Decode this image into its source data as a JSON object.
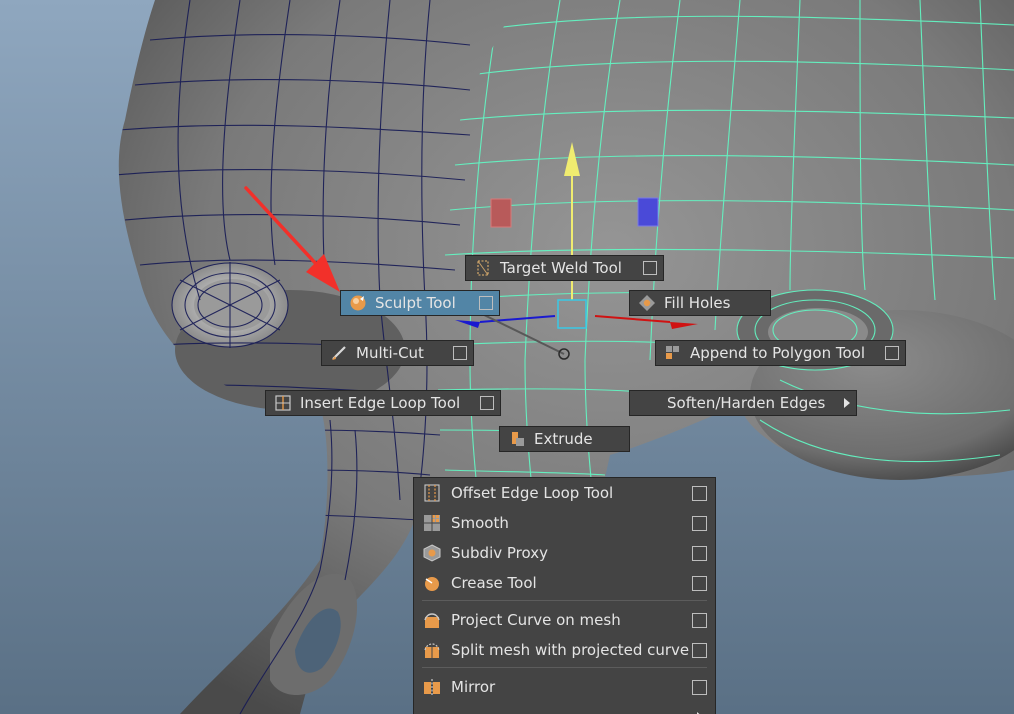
{
  "colors": {
    "viewport_top": "#8fa7bf",
    "viewport_bottom": "#5a7085",
    "mesh_fill": "#7a7a7a",
    "selected_wire": "#63f5c2",
    "unselected_wire": "#161a55",
    "menu_bg": "#444444",
    "menu_highlight": "#5285a6",
    "menu_text": "#e4e4e4",
    "annotation_arrow": "#f2302a",
    "manipulator_y": "#f0ec70",
    "manipulator_x": "#d01212",
    "manipulator_z": "#1a1ad0",
    "manipulator_center": "#39c9e6"
  },
  "marking_menu": {
    "north": {
      "label": "Target Weld Tool",
      "icon": "target-weld-icon"
    },
    "west": {
      "label": "Sculpt Tool",
      "icon": "sculpt-icon",
      "highlighted": true
    },
    "east": {
      "label": "Fill Holes",
      "icon": "fill-holes-icon"
    },
    "northwest_lower": {
      "label": "Multi-Cut",
      "icon": "multi-cut-icon"
    },
    "southeast": {
      "label": "Append to Polygon Tool",
      "icon": "append-polygon-icon"
    },
    "southwest": {
      "label": "Insert Edge Loop Tool",
      "icon": "insert-edge-loop-icon"
    },
    "southeast_lower": {
      "label": "Soften/Harden Edges",
      "has_submenu": true
    },
    "south": {
      "label": "Extrude",
      "icon": "extrude-icon"
    }
  },
  "overflow_menu": {
    "items": [
      {
        "label": "Offset Edge Loop Tool",
        "icon": "offset-edge-loop-icon"
      },
      {
        "label": "Smooth",
        "icon": "smooth-icon"
      },
      {
        "label": "Subdiv Proxy",
        "icon": "subdiv-proxy-icon"
      },
      {
        "label": "Crease Tool",
        "icon": "crease-icon"
      },
      {
        "label": "Project Curve on mesh",
        "icon": "project-curve-icon"
      },
      {
        "label": "Split mesh with projected curve",
        "icon": "split-mesh-icon"
      },
      {
        "label": "Mirror",
        "icon": "mirror-icon"
      }
    ]
  }
}
